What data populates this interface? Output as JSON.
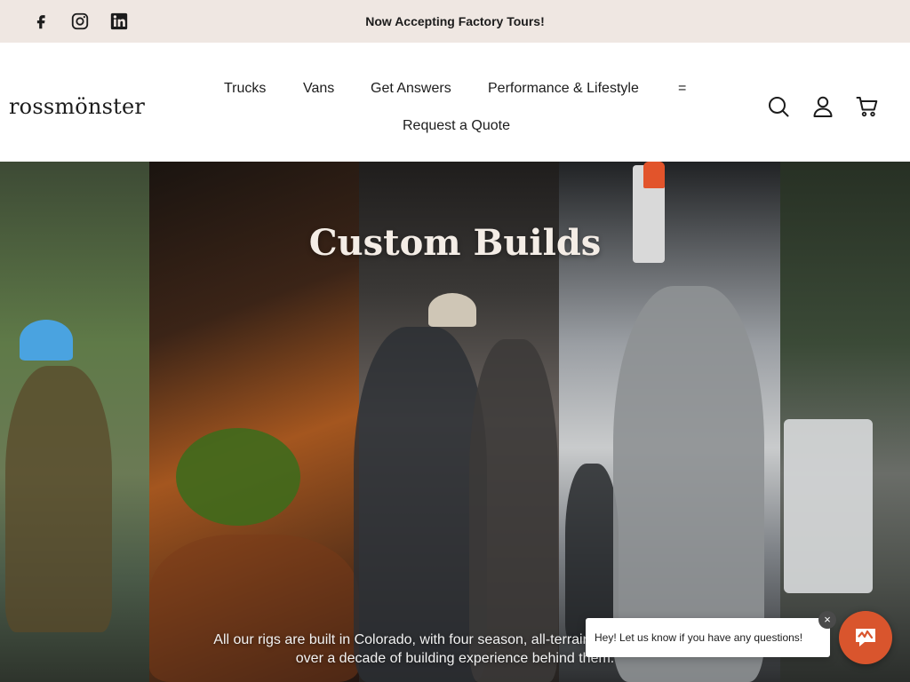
{
  "announcement": {
    "text": "Now Accepting Factory Tours!",
    "social": [
      "facebook-icon",
      "instagram-icon",
      "linkedin-icon"
    ]
  },
  "header": {
    "logo": "rossmönster",
    "nav": {
      "trucks": "Trucks",
      "vans": "Vans",
      "get_answers": "Get Answers",
      "performance": "Performance & Lifestyle",
      "more": "=",
      "request_quote": "Request a Quote"
    },
    "icons": [
      "search-icon",
      "account-icon",
      "cart-icon"
    ]
  },
  "hero": {
    "title": "Custom Builds",
    "description": "All our rigs are built in Colorado, with four season, all-terrain capabilities, and over a decade of building experience behind them."
  },
  "chat": {
    "message": "Hey! Let us know if you have any questions!",
    "close_label": "×",
    "accent": "#d9552d"
  },
  "colors": {
    "announcement_bg": "#efe7e2",
    "text": "#1c1c1c",
    "hero_title": "#f4ede6"
  }
}
